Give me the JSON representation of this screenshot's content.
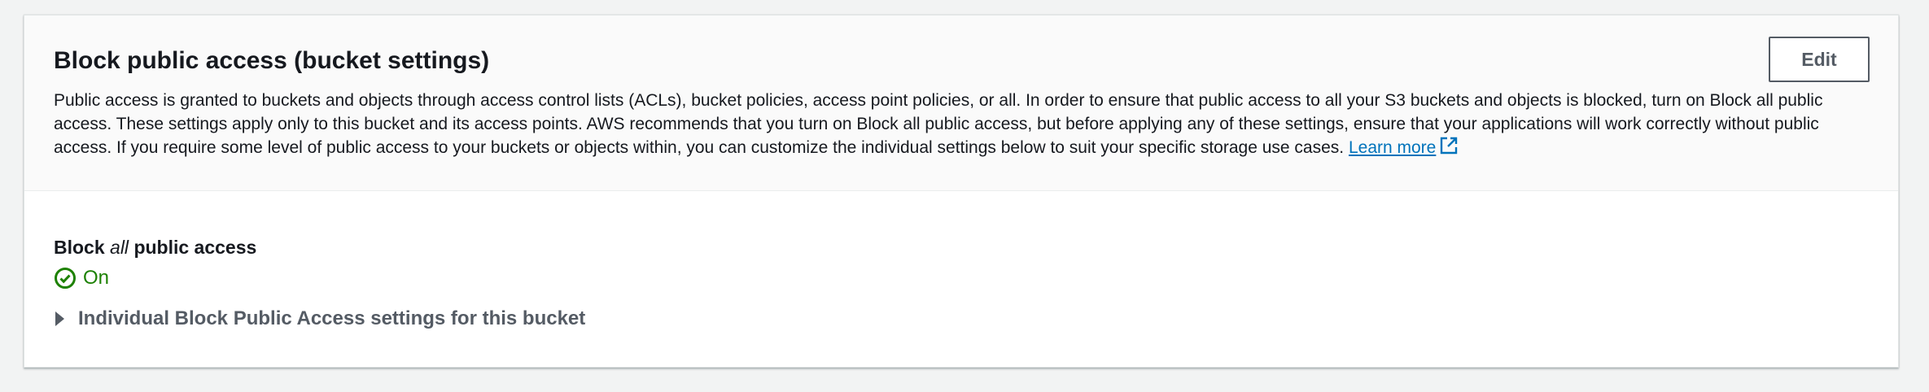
{
  "panel": {
    "title": "Block public access (bucket settings)",
    "description": "Public access is granted to buckets and objects through access control lists (ACLs), bucket policies, access point policies, or all. In order to ensure that public access to all your S3 buckets and objects is blocked, turn on Block all public access. These settings apply only to this bucket and its access points. AWS recommends that you turn on Block all public access, but before applying any of these settings, ensure that your applications will work correctly without public access. If you require some level of public access to your buckets or objects within, you can customize the individual settings below to suit your specific storage use cases.",
    "learn_more": "Learn more",
    "edit_label": "Edit"
  },
  "block_all": {
    "label_prefix": "Block",
    "label_emphasis": "all",
    "label_suffix": "public access",
    "status": "On",
    "status_color": "#1d8102",
    "status_icon": "check-circle-icon"
  },
  "individual_settings": {
    "label": "Individual Block Public Access settings for this bucket",
    "icon": "caret-right-icon"
  },
  "colors": {
    "link": "#0073bb",
    "button_border": "#545b64",
    "header_bg": "#fafafa"
  }
}
